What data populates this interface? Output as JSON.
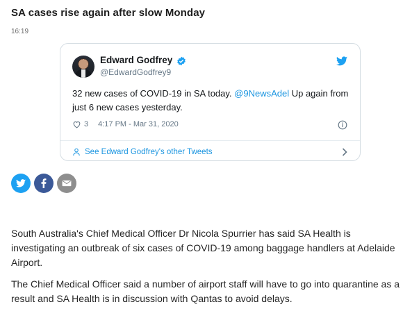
{
  "article": {
    "headline": "SA cases rise again after slow Monday",
    "time": "16:19"
  },
  "tweet": {
    "author_name": "Edward Godfrey",
    "handle": "@EdwardGodfrey9",
    "text_before": "32 new cases of COVID-19 in SA today. ",
    "mention": "@9NewsAdel",
    "text_after": " Up again from just 6 new cases yesterday.",
    "likes": "3",
    "timestamp": "4:17 PM - Mar 31, 2020",
    "other_tweets_label": "See Edward Godfrey's other Tweets",
    "icons": [
      "verified-badge-icon",
      "twitter-bird-icon",
      "heart-icon",
      "info-icon",
      "person-icon",
      "chevron-right-icon"
    ]
  },
  "share": {
    "buttons": [
      "twitter",
      "facebook",
      "email"
    ],
    "colors": {
      "twitter": "#1da1f2",
      "facebook": "#3b5998",
      "email": "#8e8e8e"
    }
  },
  "body": {
    "paragraphs": [
      "South Australia's Chief Medical Officer Dr Nicola Spurrier has said SA Health is investigating an outbreak of six cases of COVID-19 among baggage handlers at Adelaide Airport.",
      "The Chief Medical Officer said a number of airport staff will have to go into quarantine as a result and SA Health is in discussion with Qantas to avoid delays."
    ]
  },
  "colors": {
    "link": "#1b95e0",
    "muted": "#657786"
  }
}
